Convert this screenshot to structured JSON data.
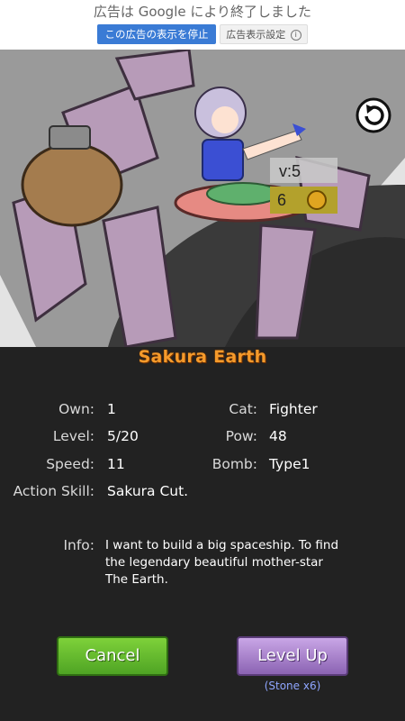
{
  "ad": {
    "title": "広告は Google により終了しました",
    "stop_button": "この広告の表示を停止",
    "settings_button": "広告表示設定",
    "info_icon": "i"
  },
  "hero": {
    "level_badge": "v:5",
    "badge_count": "6"
  },
  "character": {
    "name": "Sakura Earth",
    "stats": {
      "own_label": "Own:",
      "own_value": "1",
      "cat_label": "Cat:",
      "cat_value": "Fighter",
      "level_label": "Level:",
      "level_value": "5/20",
      "pow_label": "Pow:",
      "pow_value": "48",
      "speed_label": "Speed:",
      "speed_value": "11",
      "bomb_label": "Bomb:",
      "bomb_value": "Type1",
      "skill_label": "Action Skill:",
      "skill_value": "Sakura Cut."
    },
    "info_label": "Info:",
    "info_text": "I want to build a big spaceship. To find the legendary beautiful mother-star The Earth."
  },
  "buttons": {
    "cancel": "Cancel",
    "level_up": "Level Up",
    "level_up_cost": "(Stone x6)"
  },
  "colors": {
    "name_orange": "#f59a2b",
    "cancel_green": "#5fb22c",
    "levelup_purple": "#a47fc9",
    "cost_blue": "#8fa6ff"
  }
}
